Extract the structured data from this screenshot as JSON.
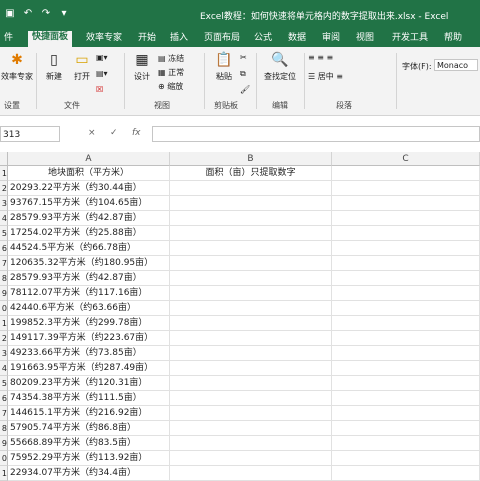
{
  "window": {
    "title": "Excel教程：如何快速将单元格内的数字提取出来.xlsx  -  Excel"
  },
  "ribbon_tabs": [
    "件",
    "快捷面板",
    "效率专家",
    "开始",
    "插入",
    "页面布局",
    "公式",
    "数据",
    "审阅",
    "视图",
    "开发工具",
    "帮助"
  ],
  "ribbon": {
    "settings_group": {
      "button": "效率专家",
      "label": "设置"
    },
    "file_group": {
      "new": "新建",
      "open": "打开",
      "label": "文件"
    },
    "view_group": {
      "design": "设计",
      "freeze": "冻结",
      "normal": "正常",
      "zoom": "缩放",
      "label": "视图"
    },
    "clipboard_group": {
      "paste": "粘贴",
      "label": "剪贴板"
    },
    "edit_group": {
      "find": "查找定位",
      "label": "编辑"
    },
    "paragraph_group": {
      "center": "居中",
      "label": "段落"
    },
    "font_group": {
      "label": "字体(F):",
      "value": "Monaco"
    }
  },
  "formula_bar": {
    "name_box": "313",
    "cancel": "×",
    "confirm": "✓",
    "fx": "fx",
    "value": ""
  },
  "sheet": {
    "columns": [
      "A",
      "B",
      "C"
    ],
    "rows": [
      {
        "num": "1",
        "a": "地块面积（平方米）",
        "b": "面积（亩）只提取数字"
      },
      {
        "num": "2",
        "a": "20293.22平方米（约30.44亩）",
        "b": ""
      },
      {
        "num": "3",
        "a": "93767.15平方米（约104.65亩）",
        "b": ""
      },
      {
        "num": "4",
        "a": "28579.93平方米（约42.87亩）",
        "b": ""
      },
      {
        "num": "5",
        "a": "17254.02平方米（约25.88亩）",
        "b": ""
      },
      {
        "num": "6",
        "a": "44524.5平方米（约66.78亩）",
        "b": ""
      },
      {
        "num": "7",
        "a": "120635.32平方米（约180.95亩）",
        "b": ""
      },
      {
        "num": "8",
        "a": "28579.93平方米（约42.87亩）",
        "b": ""
      },
      {
        "num": "9",
        "a": "78112.07平方米（约117.16亩）",
        "b": ""
      },
      {
        "num": "0",
        "a": "42440.6平方米（约63.66亩）",
        "b": ""
      },
      {
        "num": "1",
        "a": "199852.3平方米（约299.78亩）",
        "b": ""
      },
      {
        "num": "2",
        "a": "149117.39平方米（约223.67亩）",
        "b": ""
      },
      {
        "num": "3",
        "a": "49233.66平方米（约73.85亩）",
        "b": ""
      },
      {
        "num": "4",
        "a": "191663.95平方米（约287.49亩）",
        "b": ""
      },
      {
        "num": "5",
        "a": "80209.23平方米（约120.31亩）",
        "b": ""
      },
      {
        "num": "6",
        "a": "74354.38平方米（约111.5亩）",
        "b": ""
      },
      {
        "num": "7",
        "a": "144615.1平方米（约216.92亩）",
        "b": ""
      },
      {
        "num": "8",
        "a": "57905.74平方米（约86.8亩）",
        "b": ""
      },
      {
        "num": "9",
        "a": "55668.89平方米（约83.5亩）",
        "b": ""
      },
      {
        "num": "0",
        "a": "75952.29平方米（约113.92亩）",
        "b": ""
      },
      {
        "num": "1",
        "a": "22934.07平方米（约34.4亩）",
        "b": ""
      }
    ]
  },
  "colors": {
    "accent": "#217346",
    "ribbon_bg": "#f3f3f3",
    "header_bg": "#f2f2f2",
    "grid": "#e1e1e1"
  }
}
